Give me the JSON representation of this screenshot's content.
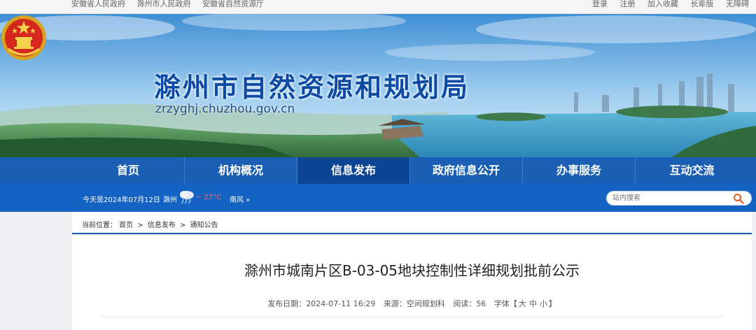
{
  "topbar": {
    "links_left": [
      "安徽省人民政府",
      "滁州市人民政府",
      "安徽省自然资源厅"
    ],
    "links_right": [
      "登录",
      "注册",
      "加入收藏",
      "长辈版",
      "无障碍"
    ]
  },
  "header": {
    "title": "滁州市自然资源和规划局",
    "domain": "zrzyghj.chuzhou.gov.cn"
  },
  "nav": {
    "items": [
      "首页",
      "机构概况",
      "信息发布",
      "政府信息公开",
      "办事服务",
      "互动交流"
    ],
    "active_index": 2
  },
  "infobar": {
    "date": "今天是2024年07月12日",
    "city": "滁州",
    "temp": "~ 27°C",
    "wind": "南风 »"
  },
  "search": {
    "placeholder": "站内搜索"
  },
  "breadcrumb": {
    "prefix": "当前位置：",
    "items": [
      "首页",
      "信息发布",
      "通知公告"
    ],
    "sep": ">"
  },
  "article": {
    "title": "滁州市城南片区B-03-05地块控制性详细规划批前公示",
    "date_label": "发布日期：",
    "date": "2024-07-11 16:29",
    "source_label": "来源：",
    "source": "空间规划科",
    "views_label": "阅读：",
    "views": "56",
    "font_label": "字体【",
    "font_large": "大",
    "font_medium": "中",
    "font_small": "小",
    "font_close": "】"
  },
  "colors": {
    "nav": "#1a5fb4",
    "nav_active": "#0b4593",
    "subbar": "#1463c2",
    "title": "#0d4aa3"
  }
}
